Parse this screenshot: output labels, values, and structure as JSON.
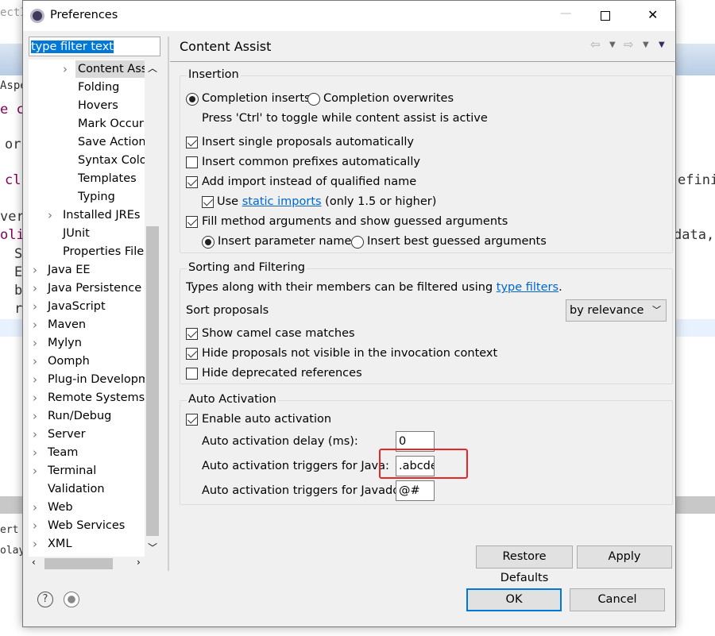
{
  "background": {
    "fragments": [
      "ectIn",
      "Aspe",
      "e c",
      "or",
      "cl",
      "ver",
      "oli",
      "S",
      "E",
      "b",
      "r",
      "ert",
      "olay",
      "efini",
      "data,"
    ]
  },
  "window": {
    "title": "Preferences",
    "minimize": "—",
    "maximize": "□",
    "close": "✕"
  },
  "filter": {
    "value": "type filter text"
  },
  "tree": {
    "items": [
      {
        "label": "Content Assist",
        "level": 3,
        "chevron": true,
        "selected": true
      },
      {
        "label": "Folding",
        "level": 3
      },
      {
        "label": "Hovers",
        "level": 3
      },
      {
        "label": "Mark Occurrences",
        "level": 3
      },
      {
        "label": "Save Actions",
        "level": 3
      },
      {
        "label": "Syntax Coloring",
        "level": 3
      },
      {
        "label": "Templates",
        "level": 3
      },
      {
        "label": "Typing",
        "level": 3
      },
      {
        "label": "Installed JREs",
        "level": 2,
        "chevron": true
      },
      {
        "label": "JUnit",
        "level": 2
      },
      {
        "label": "Properties Files Editor",
        "level": 2
      },
      {
        "label": "Java EE",
        "level": 1,
        "chevron": true
      },
      {
        "label": "Java Persistence",
        "level": 1,
        "chevron": true
      },
      {
        "label": "JavaScript",
        "level": 1,
        "chevron": true
      },
      {
        "label": "Maven",
        "level": 1,
        "chevron": true
      },
      {
        "label": "Mylyn",
        "level": 1,
        "chevron": true
      },
      {
        "label": "Oomph",
        "level": 1,
        "chevron": true
      },
      {
        "label": "Plug-in Development",
        "level": 1,
        "chevron": true
      },
      {
        "label": "Remote Systems",
        "level": 1,
        "chevron": true
      },
      {
        "label": "Run/Debug",
        "level": 1,
        "chevron": true
      },
      {
        "label": "Server",
        "level": 1,
        "chevron": true
      },
      {
        "label": "Team",
        "level": 1,
        "chevron": true
      },
      {
        "label": "Terminal",
        "level": 1,
        "chevron": true
      },
      {
        "label": "Validation",
        "level": 1
      },
      {
        "label": "Web",
        "level": 1,
        "chevron": true
      },
      {
        "label": "Web Services",
        "level": 1,
        "chevron": true
      },
      {
        "label": "XML",
        "level": 1,
        "chevron": true
      }
    ]
  },
  "page": {
    "title": "Content Assist"
  },
  "insertion": {
    "label": "Insertion",
    "completion_inserts": "Completion inserts",
    "completion_overwrites": "Completion overwrites",
    "selected": "Completion inserts",
    "toggle_hint": "Press 'Ctrl' to toggle while content assist is active",
    "single_proposals": {
      "label": "Insert single proposals automatically",
      "checked": true
    },
    "common_prefixes": {
      "label": "Insert common prefixes automatically",
      "checked": false
    },
    "add_import": {
      "label": "Add import instead of qualified name",
      "checked": true
    },
    "static_imports": {
      "pre": "Use ",
      "link": "static imports",
      "post": " (only 1.5 or higher)",
      "checked": true
    },
    "fill_args": {
      "label": "Fill method arguments and show guessed arguments",
      "checked": true
    },
    "param_names": "Insert parameter names",
    "best_guessed": "Insert best guessed arguments",
    "arg_selected": "Insert parameter names"
  },
  "sorting": {
    "label": "Sorting and Filtering",
    "desc_pre": "Types along with their members can be filtered using ",
    "desc_link": "type filters",
    "desc_post": ".",
    "sort_label": "Sort proposals",
    "sort_value": "by relevance",
    "camel": {
      "label": "Show camel case matches",
      "checked": true
    },
    "hide_invisible": {
      "label": "Hide proposals not visible in the invocation context",
      "checked": true
    },
    "hide_deprecated": {
      "label": "Hide deprecated references",
      "checked": false
    }
  },
  "auto": {
    "label": "Auto Activation",
    "enable": {
      "label": "Enable auto activation",
      "checked": true
    },
    "delay_label": "Auto activation delay (ms):",
    "delay_value": "0",
    "java_label": "Auto activation triggers for Java:",
    "java_value": ".abcde",
    "javadoc_label": "Auto activation triggers for Javadoc:",
    "javadoc_value": "@#"
  },
  "buttons": {
    "restore": "Restore Defaults",
    "apply": "Apply",
    "ok": "OK",
    "cancel": "Cancel"
  },
  "colors": {
    "highlight": "#e8262a",
    "selection": "#0078d7",
    "link": "#0066cc"
  }
}
